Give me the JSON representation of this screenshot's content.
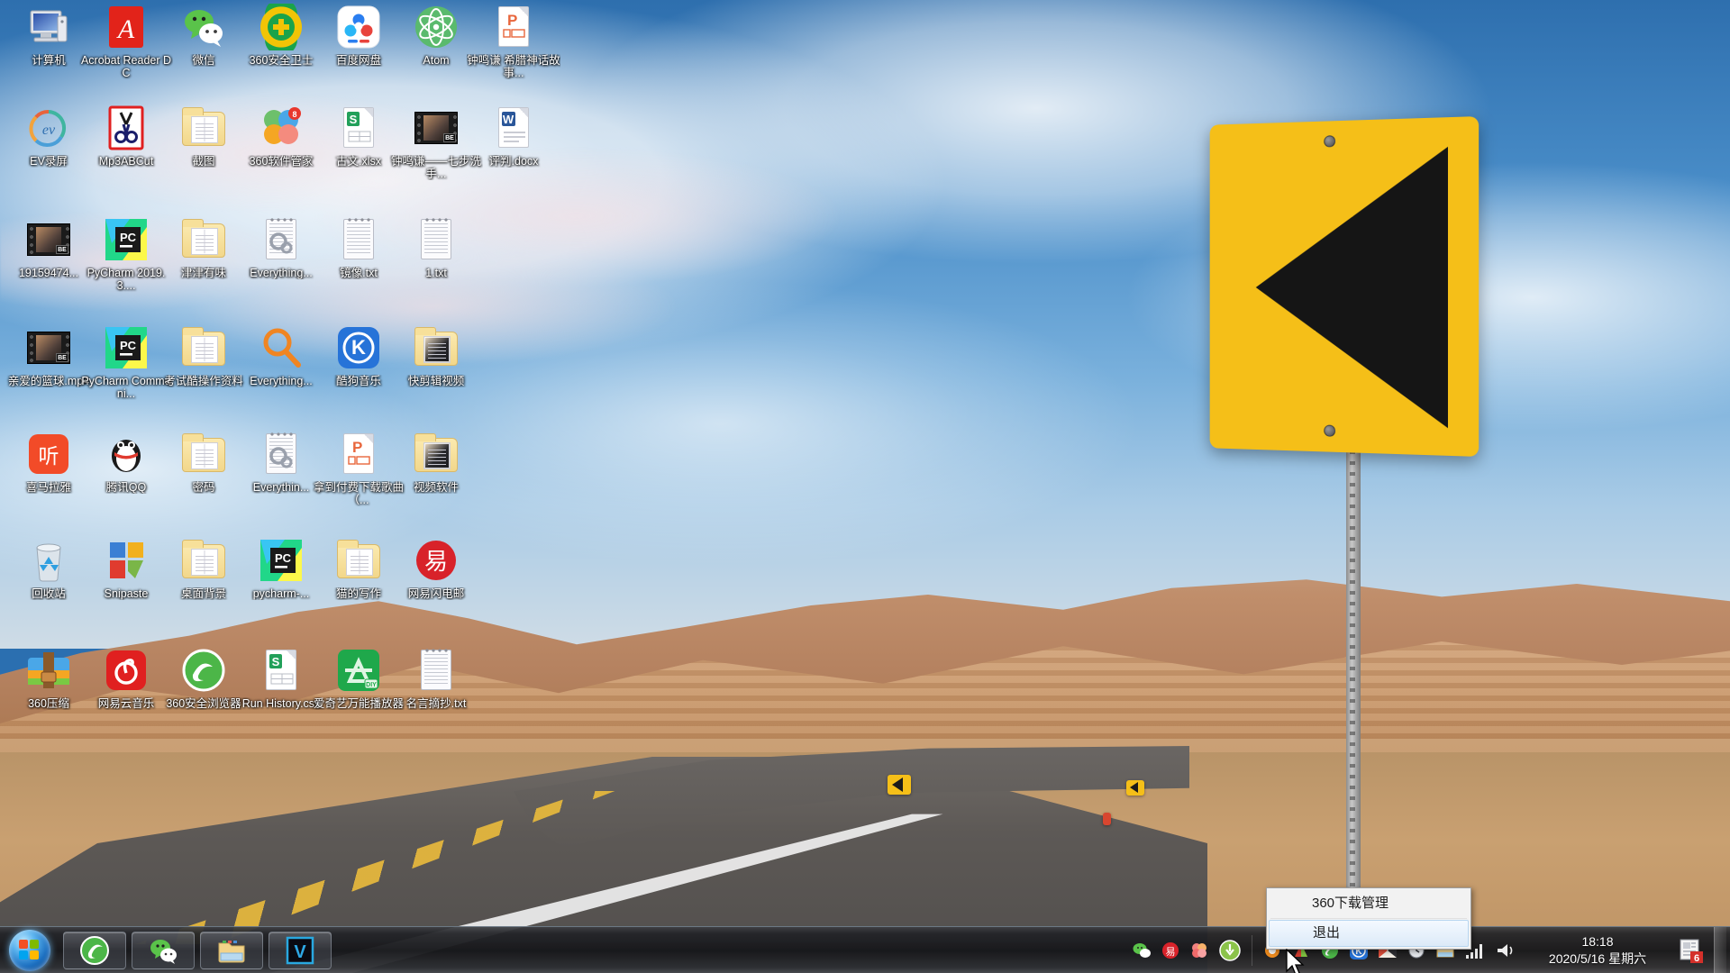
{
  "desktop": {
    "wallpaper_description": "desert highway with yellow chevron road sign",
    "icons": [
      {
        "label": "计算机",
        "type": "computer"
      },
      {
        "label": "Acrobat Reader DC",
        "type": "acrobat"
      },
      {
        "label": "微信",
        "type": "wechat"
      },
      {
        "label": "360安全卫士",
        "type": "360safe"
      },
      {
        "label": "百度网盘",
        "type": "baiduyun"
      },
      {
        "label": "Atom",
        "type": "atom"
      },
      {
        "label": "钟鸣谦 希腊神话故事...",
        "type": "pptfile"
      },
      {
        "label": "EV录屏",
        "type": "evcapture"
      },
      {
        "label": "Mp3ABCut",
        "type": "mp3abcut"
      },
      {
        "label": "截图",
        "type": "folder"
      },
      {
        "label": "360软件管家",
        "type": "360soft"
      },
      {
        "label": "古文.xlsx",
        "type": "xlsx"
      },
      {
        "label": "钟鸣谦——七步洗手...",
        "type": "video"
      },
      {
        "label": "评判.docx",
        "type": "docx"
      },
      {
        "label": "19159474...",
        "type": "video"
      },
      {
        "label": "PyCharm 2019.3....",
        "type": "pycharm"
      },
      {
        "label": "津津有味",
        "type": "folder"
      },
      {
        "label": "Everything...",
        "type": "exefile"
      },
      {
        "label": "镜像.txt",
        "type": "txt"
      },
      {
        "label": "1.txt",
        "type": "txt"
      },
      {
        "label": "亲爱的篮球.mp4",
        "type": "video"
      },
      {
        "label": "PyCharm Communi...",
        "type": "pycharm"
      },
      {
        "label": "考试酷操作资料",
        "type": "folder"
      },
      {
        "label": "Everything...",
        "type": "everything"
      },
      {
        "label": "酷狗音乐",
        "type": "kugou"
      },
      {
        "label": "快剪辑视频",
        "type": "folder-media"
      },
      {
        "label": "喜马拉雅",
        "type": "ximalaya"
      },
      {
        "label": "腾讯QQ",
        "type": "qq"
      },
      {
        "label": "密码",
        "type": "folder"
      },
      {
        "label": "Everythin...",
        "type": "exefile"
      },
      {
        "label": "拿到付费下载歌曲（...",
        "type": "pptfile"
      },
      {
        "label": "视频软件",
        "type": "folder-media"
      },
      {
        "label": "回收站",
        "type": "recycle"
      },
      {
        "label": "Snipaste",
        "type": "snipaste"
      },
      {
        "label": "桌面背景",
        "type": "folder"
      },
      {
        "label": "pycharm-...",
        "type": "pycharm"
      },
      {
        "label": "猫的写作",
        "type": "folder"
      },
      {
        "label": "网易闪电邮",
        "type": "netease-mail"
      },
      {
        "label": "360压缩",
        "type": "360zip"
      },
      {
        "label": "网易云音乐",
        "type": "netease-music"
      },
      {
        "label": "360安全浏览器",
        "type": "360browser"
      },
      {
        "label": "Run History.csv",
        "type": "csv"
      },
      {
        "label": "爱奇艺万能播放器",
        "type": "iqiyi"
      },
      {
        "label": "名言摘抄.txt",
        "type": "txt"
      }
    ]
  },
  "context_menu": {
    "items": [
      {
        "label": "360下载管理",
        "selected": false
      },
      {
        "label": "退出",
        "selected": true
      }
    ]
  },
  "taskbar": {
    "start_tooltip": "开始",
    "buttons": [
      {
        "name": "360安全浏览器",
        "type": "360browser"
      },
      {
        "name": "微信",
        "type": "wechat"
      },
      {
        "name": "资源管理器",
        "type": "explorer"
      },
      {
        "name": "V",
        "type": "vapp"
      }
    ],
    "tray_icons": [
      {
        "name": "wechat-tray"
      },
      {
        "name": "netease-mail-tray"
      },
      {
        "name": "360soft-tray"
      },
      {
        "name": "360download-tray"
      },
      {
        "name": "hidden-orange-tray"
      },
      {
        "name": "hidden-red-tray"
      },
      {
        "name": "360browser-tray"
      },
      {
        "name": "kugou-tray"
      },
      {
        "name": "media-tray"
      },
      {
        "name": "clock-tray"
      },
      {
        "name": "network-tray"
      }
    ],
    "network_icon": "signal-bars-icon",
    "volume_icon": "speaker-icon",
    "clock": {
      "time": "18:18",
      "date": "2020/5/16 星期六"
    },
    "action_center_badge": "6"
  }
}
